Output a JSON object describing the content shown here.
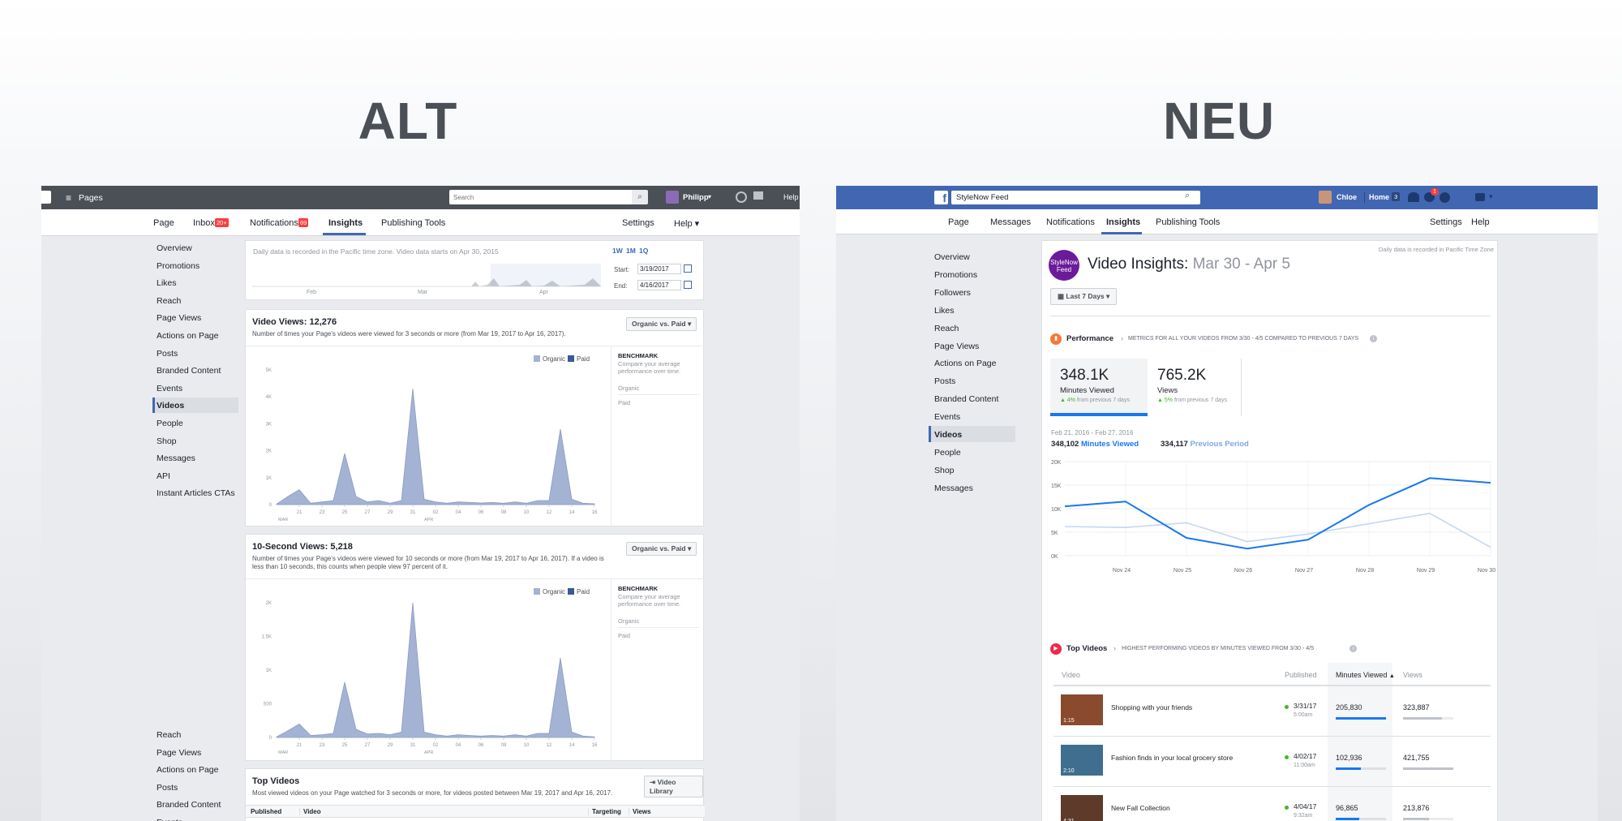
{
  "headings": {
    "alt": "ALT",
    "neu": "NEU"
  },
  "alt": {
    "topbar": {
      "pages": "Pages",
      "search_placeholder": "Search",
      "user": "Philipp",
      "help": "Help"
    },
    "tabs": [
      {
        "label": "Page"
      },
      {
        "label": "Inbox",
        "badge": "20+"
      },
      {
        "label": "Notifications",
        "badge": "69"
      },
      {
        "label": "Insights"
      },
      {
        "label": "Publishing Tools"
      },
      {
        "label": "Settings"
      },
      {
        "label": "Help ▾"
      }
    ],
    "sidebar": [
      "Overview",
      "Promotions",
      "Likes",
      "Reach",
      "Page Views",
      "Actions on Page",
      "Posts",
      "Branded Content",
      "Events",
      "Videos",
      "People",
      "Shop",
      "Messages",
      "API",
      "Instant Articles CTAs"
    ],
    "sidebar2": [
      "Reach",
      "Page Views",
      "Actions on Page",
      "Posts",
      "Branded Content",
      "Events"
    ],
    "range": {
      "note": "Daily data is recorded in the Pacific time zone. Video data starts on Apr 30, 2015",
      "w1": "1W",
      "m1": "1M",
      "q1": "1Q",
      "start_label": "Start:",
      "start": "3/19/2017",
      "end_label": "End:",
      "end": "4/16/2017",
      "months": [
        "Feb",
        "Mar",
        "Apr"
      ]
    },
    "views": {
      "title": "Video Views: 12,276",
      "desc": "Number of times your Page's videos were viewed for 3 seconds or more (from Mar 19, 2017 to Apr 16, 2017).",
      "dropdown": "Organic vs. Paid ▾",
      "legend": [
        "Organic",
        "Paid"
      ],
      "benchmark": "BENCHMARK",
      "benchmark_desc": "Compare your average performance over time.",
      "organic": "Organic",
      "paid": "Paid"
    },
    "ten": {
      "title": "10-Second Views: 5,218",
      "desc": "Number of times your Page's videos were viewed for 10 seconds or more (from Mar 19, 2017 to Apr 16, 2017). If a video is less than 10 seconds, this counts when people view 97 percent of it.",
      "dropdown": "Organic vs. Paid ▾",
      "legend": [
        "Organic",
        "Paid"
      ],
      "benchmark": "BENCHMARK",
      "benchmark_desc": "Compare your average performance over time.",
      "organic": "Organic",
      "paid": "Paid"
    },
    "top": {
      "title": "Top Videos",
      "desc": "Most viewed videos on your Page watched for 3 seconds or more, for videos posted between Mar 19, 2017 and Apr 16, 2017.",
      "library": "Video Library",
      "columns": [
        "Published",
        "Video",
        "Targeting",
        "Views"
      ]
    }
  },
  "neu": {
    "topbar": {
      "search": "StyleNow Feed",
      "user": "Chloe",
      "home": "Home",
      "home_count": "3",
      "notif": "1"
    },
    "tabs": [
      "Page",
      "Messages",
      "Notifications",
      "Insights",
      "Publishing Tools",
      "Settings",
      "Help"
    ],
    "sidebar": [
      "Overview",
      "Promotions",
      "Followers",
      "Likes",
      "Reach",
      "Page Views",
      "Actions on Page",
      "Posts",
      "Branded Content",
      "Events",
      "Videos",
      "People",
      "Shop",
      "Messages"
    ],
    "avatar_text": "StyleNow Feed",
    "title": "Video Insights:",
    "title_range": "Mar 30 - Apr 5",
    "tz_note": "Daily data is recorded in Pacific Time Zone",
    "period_button": "Last 7 Days",
    "performance": {
      "label": "Performance",
      "desc": "METRICS FOR ALL YOUR VIDEOS FROM 3/30 - 4/5 COMPARED TO PREVIOUS 7 DAYS",
      "m1_value": "348.1K",
      "m1_label": "Minutes Viewed",
      "m1_delta": "4%",
      "m1_note": "from previous 7 days",
      "m2_value": "765.2K",
      "m2_label": "Views",
      "m2_delta": "5%",
      "m2_note": "from previous 7 days",
      "date_range": "Feb 21, 2016 - Feb 27, 2016",
      "cur_value": "348,102",
      "cur_label": "Minutes Viewed",
      "prev_value": "334,117",
      "prev_label": "Previous Period"
    },
    "top_videos": {
      "label": "Top Videos",
      "desc": "HIGHEST PERFORMING VIDEOS BY MINUTES VIEWED FROM 3/30 - 4/5",
      "columns": [
        "Video",
        "Published",
        "Minutes Viewed",
        "Views"
      ],
      "rows": [
        {
          "title": "Shopping with your friends",
          "date": "3/31/17",
          "time": "5:00am",
          "minutes": "205,830",
          "views": "323,887",
          "duration": "1:15",
          "min_frac": 1.0,
          "views_frac": 0.77
        },
        {
          "title": "Fashion finds in your local grocery store",
          "date": "4/02/17",
          "time": "11:00am",
          "minutes": "102,936",
          "views": "421,755",
          "duration": "2:10",
          "min_frac": 0.5,
          "views_frac": 1.0
        },
        {
          "title": "New Fall Collection",
          "date": "4/04/17",
          "time": "9:32am",
          "minutes": "96,865",
          "views": "213,876",
          "duration": "4:31",
          "min_frac": 0.47,
          "views_frac": 0.51
        }
      ]
    }
  },
  "chart_data": [
    {
      "type": "area",
      "title": "Video Views: 12,276",
      "x": [
        "Mar 19",
        "Mar 20",
        "Mar 21",
        "Mar 22",
        "Mar 23",
        "Mar 24",
        "Mar 25",
        "Mar 26",
        "Mar 27",
        "Mar 28",
        "Mar 29",
        "Mar 30",
        "Mar 31",
        "Apr 1",
        "Apr 2",
        "Apr 3",
        "Apr 4",
        "Apr 5",
        "Apr 6",
        "Apr 7",
        "Apr 8",
        "Apr 9",
        "Apr 10",
        "Apr 11",
        "Apr 12",
        "Apr 13",
        "Apr 14",
        "Apr 15",
        "Apr 16"
      ],
      "x_ticks": [
        "21",
        "23",
        "25",
        "27",
        "29",
        "31",
        "02",
        "04",
        "06",
        "08",
        "10",
        "12",
        "14",
        "16"
      ],
      "month_labels": [
        "MAR",
        "APR"
      ],
      "y_ticks": [
        "0",
        "1K",
        "2K",
        "3K",
        "4K",
        "5K"
      ],
      "ylim": [
        0,
        5000
      ],
      "series": [
        {
          "name": "Organic",
          "values": [
            20,
            300,
            550,
            50,
            100,
            150,
            1900,
            300,
            100,
            150,
            50,
            150,
            4300,
            200,
            100,
            50,
            100,
            80,
            60,
            80,
            50,
            100,
            50,
            150,
            150,
            2800,
            200,
            50,
            30
          ]
        },
        {
          "name": "Paid",
          "values": [
            0,
            0,
            0,
            0,
            0,
            0,
            0,
            0,
            0,
            0,
            0,
            0,
            0,
            0,
            0,
            0,
            0,
            0,
            0,
            0,
            0,
            0,
            0,
            0,
            0,
            0,
            0,
            0,
            0
          ]
        }
      ]
    },
    {
      "type": "area",
      "title": "10-Second Views: 5,218",
      "x": [
        "Mar 19",
        "Mar 20",
        "Mar 21",
        "Mar 22",
        "Mar 23",
        "Mar 24",
        "Mar 25",
        "Mar 26",
        "Mar 27",
        "Mar 28",
        "Mar 29",
        "Mar 30",
        "Mar 31",
        "Apr 1",
        "Apr 2",
        "Apr 3",
        "Apr 4",
        "Apr 5",
        "Apr 6",
        "Apr 7",
        "Apr 8",
        "Apr 9",
        "Apr 10",
        "Apr 11",
        "Apr 12",
        "Apr 13",
        "Apr 14",
        "Apr 15",
        "Apr 16"
      ],
      "x_ticks": [
        "21",
        "23",
        "25",
        "27",
        "29",
        "31",
        "02",
        "04",
        "06",
        "08",
        "10",
        "12",
        "14",
        "16"
      ],
      "month_labels": [
        "MAR",
        "APR"
      ],
      "y_ticks": [
        "0",
        "500",
        "1K",
        "1.5K",
        "2K"
      ],
      "ylim": [
        0,
        2000
      ],
      "series": [
        {
          "name": "Organic",
          "values": [
            10,
            100,
            200,
            30,
            40,
            60,
            820,
            120,
            50,
            60,
            40,
            80,
            2000,
            80,
            40,
            20,
            40,
            30,
            20,
            30,
            20,
            40,
            20,
            60,
            60,
            1180,
            80,
            20,
            10
          ]
        },
        {
          "name": "Paid",
          "values": [
            0,
            0,
            0,
            0,
            0,
            0,
            0,
            0,
            0,
            0,
            0,
            0,
            0,
            0,
            0,
            0,
            0,
            0,
            0,
            0,
            0,
            0,
            0,
            0,
            0,
            0,
            0,
            0,
            0
          ]
        }
      ]
    },
    {
      "type": "line",
      "title": "",
      "categories": [
        "Nov 24",
        "Nov 25",
        "Nov 26",
        "Nov 27",
        "Nov 28",
        "Nov 29",
        "Nov 30"
      ],
      "x_points": [
        "Nov 23",
        "Nov 24",
        "Nov 25",
        "Nov 26",
        "Nov 27",
        "Nov 28",
        "Nov 29",
        "Nov 30"
      ],
      "y_ticks": [
        "0K",
        "5K",
        "10K",
        "15K",
        "20K"
      ],
      "ylim": [
        0,
        20000
      ],
      "series": [
        {
          "name": "Minutes Viewed",
          "values": [
            10500,
            11500,
            3800,
            1500,
            3400,
            10800,
            16500,
            15500
          ],
          "color": "#1877f2"
        },
        {
          "name": "Previous Period",
          "values": [
            6200,
            6000,
            7000,
            3000,
            4600,
            6800,
            9000,
            1800
          ],
          "color": "#c3d7f2"
        }
      ]
    }
  ]
}
